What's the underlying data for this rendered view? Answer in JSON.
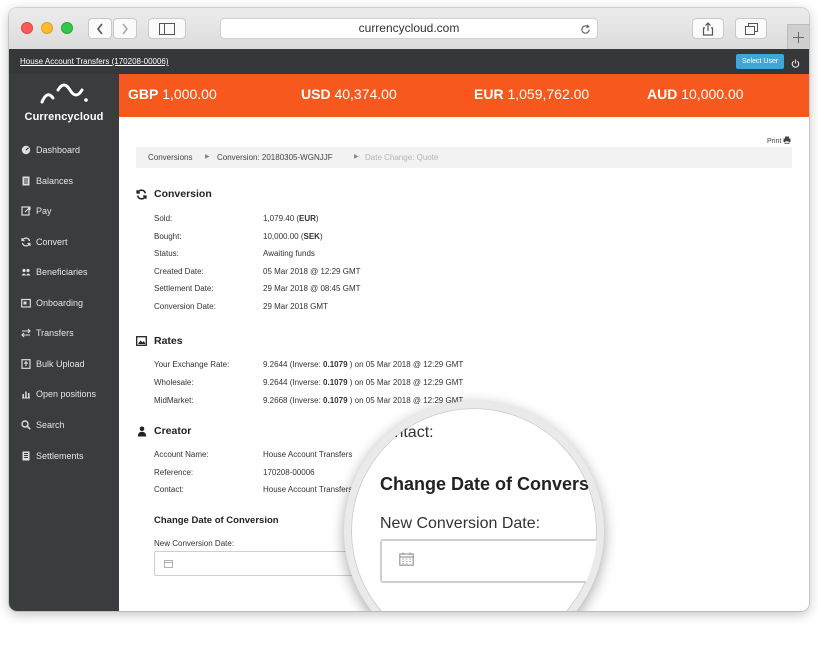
{
  "browser": {
    "url": "currencycloud.com"
  },
  "topbar": {
    "account_link": "House Account Transfers (170208-00006)",
    "select_user": "Select User"
  },
  "brand": {
    "name": "Currencycloud",
    "accent": "#f6581d"
  },
  "sidebar": {
    "items": [
      {
        "label": "Dashboard",
        "icon": "dashboard-icon"
      },
      {
        "label": "Balances",
        "icon": "balances-icon"
      },
      {
        "label": "Pay",
        "icon": "pay-icon"
      },
      {
        "label": "Convert",
        "icon": "convert-icon"
      },
      {
        "label": "Beneficiaries",
        "icon": "beneficiaries-icon"
      },
      {
        "label": "Onboarding",
        "icon": "onboarding-icon"
      },
      {
        "label": "Transfers",
        "icon": "transfers-icon"
      },
      {
        "label": "Bulk Upload",
        "icon": "bulk-upload-icon"
      },
      {
        "label": "Open positions",
        "icon": "open-positions-icon"
      },
      {
        "label": "Search",
        "icon": "search-icon"
      },
      {
        "label": "Settlements",
        "icon": "settlements-icon"
      }
    ]
  },
  "balances": [
    {
      "currency": "GBP",
      "amount": "1,000.00"
    },
    {
      "currency": "USD",
      "amount": "40,374.00"
    },
    {
      "currency": "EUR",
      "amount": "1,059,762.00"
    },
    {
      "currency": "AUD",
      "amount": "10,000.00"
    }
  ],
  "print_label": "Print",
  "breadcrumb": [
    "Conversions",
    "Conversion: 20180305-WGNJJF",
    "Date Change: Quote"
  ],
  "conversion": {
    "title": "Conversion",
    "rows": [
      {
        "label": "Sold:",
        "value": "1,079.40 (",
        "value_bold": "EUR",
        "value_end": ")"
      },
      {
        "label": "Bought:",
        "value": "10,000.00 (",
        "value_bold": "SEK",
        "value_end": ")"
      },
      {
        "label": "Status:",
        "value": "Awaiting funds"
      },
      {
        "label": "Created Date:",
        "value": "05 Mar 2018 @ 12:29 GMT"
      },
      {
        "label": "Settlement Date:",
        "value": "29 Mar 2018 @ 08:45 GMT"
      },
      {
        "label": "Conversion Date:",
        "value": "29 Mar 2018 GMT"
      }
    ]
  },
  "rates": {
    "title": "Rates",
    "rows": [
      {
        "label": "Your Exchange Rate:",
        "value": "9.2644 (Inverse: ",
        "value_bold": "0.1079",
        "value_end": " ) on 05 Mar 2018 @ 12:29 GMT"
      },
      {
        "label": "Wholesale:",
        "value": "9.2644 (Inverse: ",
        "value_bold": "0.1079",
        "value_end": " ) on 05 Mar 2018 @ 12:29 GMT"
      },
      {
        "label": "MidMarket:",
        "value": "9.2668 (Inverse: ",
        "value_bold": "0.1079",
        "value_end": " ) on 05 Mar 2018 @ 12:29 GMT"
      }
    ]
  },
  "creator": {
    "title": "Creator",
    "rows": [
      {
        "label": "Account Name:",
        "value": "House Account Transfers"
      },
      {
        "label": "Reference:",
        "value": "170208-00006"
      },
      {
        "label": "Contact:",
        "value": "House Account Transfers"
      }
    ]
  },
  "change_date": {
    "title": "Change Date of Conversion",
    "label": "New Conversion Date:"
  },
  "magnifier": {
    "contact": "Contact:",
    "title": "Change Date of Conversion",
    "label": "New Conversion Date:"
  }
}
